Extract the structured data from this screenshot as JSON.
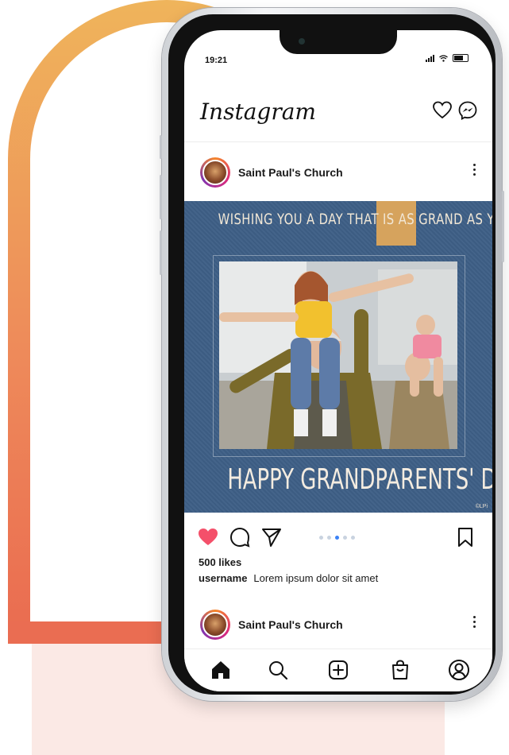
{
  "status": {
    "time": "19:21"
  },
  "app": {
    "logo": "Instagram"
  },
  "post": {
    "account": "Saint Paul's Church",
    "image": {
      "headline": "WISHING YOU A DAY THAT IS AS GRAND AS YOU ARE",
      "footer": "HAPPY GRANDPARENTS' DAY!",
      "copyright": "©LPi"
    },
    "likes": "500 likes",
    "caption_user": "username",
    "caption_text": "Lorem ipsum dolor sit amet",
    "pager_count": 5,
    "pager_active": 2
  },
  "next_post": {
    "account": "Saint Paul's Church"
  },
  "icons": {
    "header": [
      "heart-icon",
      "messenger-icon"
    ],
    "actions": [
      "like-heart-icon",
      "comment-icon",
      "share-icon",
      "bookmark-icon"
    ],
    "tabs": [
      "home-icon",
      "search-icon",
      "add-post-icon",
      "shop-icon",
      "profile-icon"
    ]
  },
  "colors": {
    "arch_top": "#efb45b",
    "arch_bottom": "#ea6b50",
    "post_background": "#3e5f86",
    "grand_highlight": "#d6a35d",
    "like_active": "#f4506a"
  }
}
